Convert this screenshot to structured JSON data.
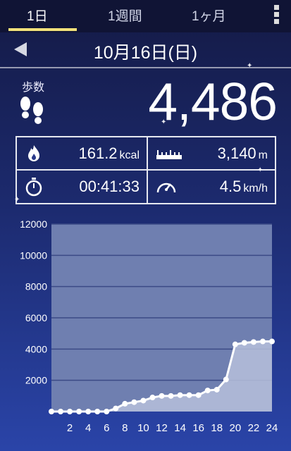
{
  "tabs": [
    {
      "label": "1日",
      "active": true
    },
    {
      "label": "1週間",
      "active": false
    },
    {
      "label": "1ヶ月",
      "active": false
    }
  ],
  "date": "10月16日(日)",
  "steps": {
    "label": "歩数",
    "value": "4,486"
  },
  "stats": {
    "calories": {
      "value": "161.2",
      "unit": "kcal",
      "icon": "flame-icon"
    },
    "distance": {
      "value": "3,140",
      "unit": "m",
      "icon": "ruler-icon"
    },
    "duration": {
      "value": "00:41:33",
      "icon": "stopwatch-icon"
    },
    "speed": {
      "value": "4.5",
      "unit": "km/h",
      "icon": "speedometer-icon"
    }
  },
  "colors": {
    "accent": "#f2e27a",
    "plot_bg": "#6f7fb0",
    "fill": "#b7c0dc"
  },
  "chart_data": {
    "type": "area",
    "x": [
      0,
      1,
      2,
      3,
      4,
      5,
      6,
      7,
      8,
      9,
      10,
      11,
      12,
      13,
      14,
      15,
      16,
      17,
      18,
      19,
      20,
      21,
      22,
      23,
      24
    ],
    "values": [
      0,
      0,
      0,
      0,
      0,
      0,
      0,
      200,
      500,
      600,
      700,
      900,
      1000,
      1000,
      1050,
      1050,
      1050,
      1350,
      1400,
      2050,
      4300,
      4400,
      4450,
      4486,
      4486
    ],
    "ylim": [
      0,
      12000
    ],
    "yticks": [
      "12000",
      "10000",
      "8000",
      "6000",
      "4000",
      "2000"
    ],
    "xticks": [
      "2",
      "4",
      "6",
      "8",
      "10",
      "12",
      "14",
      "16",
      "18",
      "20",
      "22",
      "24"
    ],
    "grid": true
  }
}
